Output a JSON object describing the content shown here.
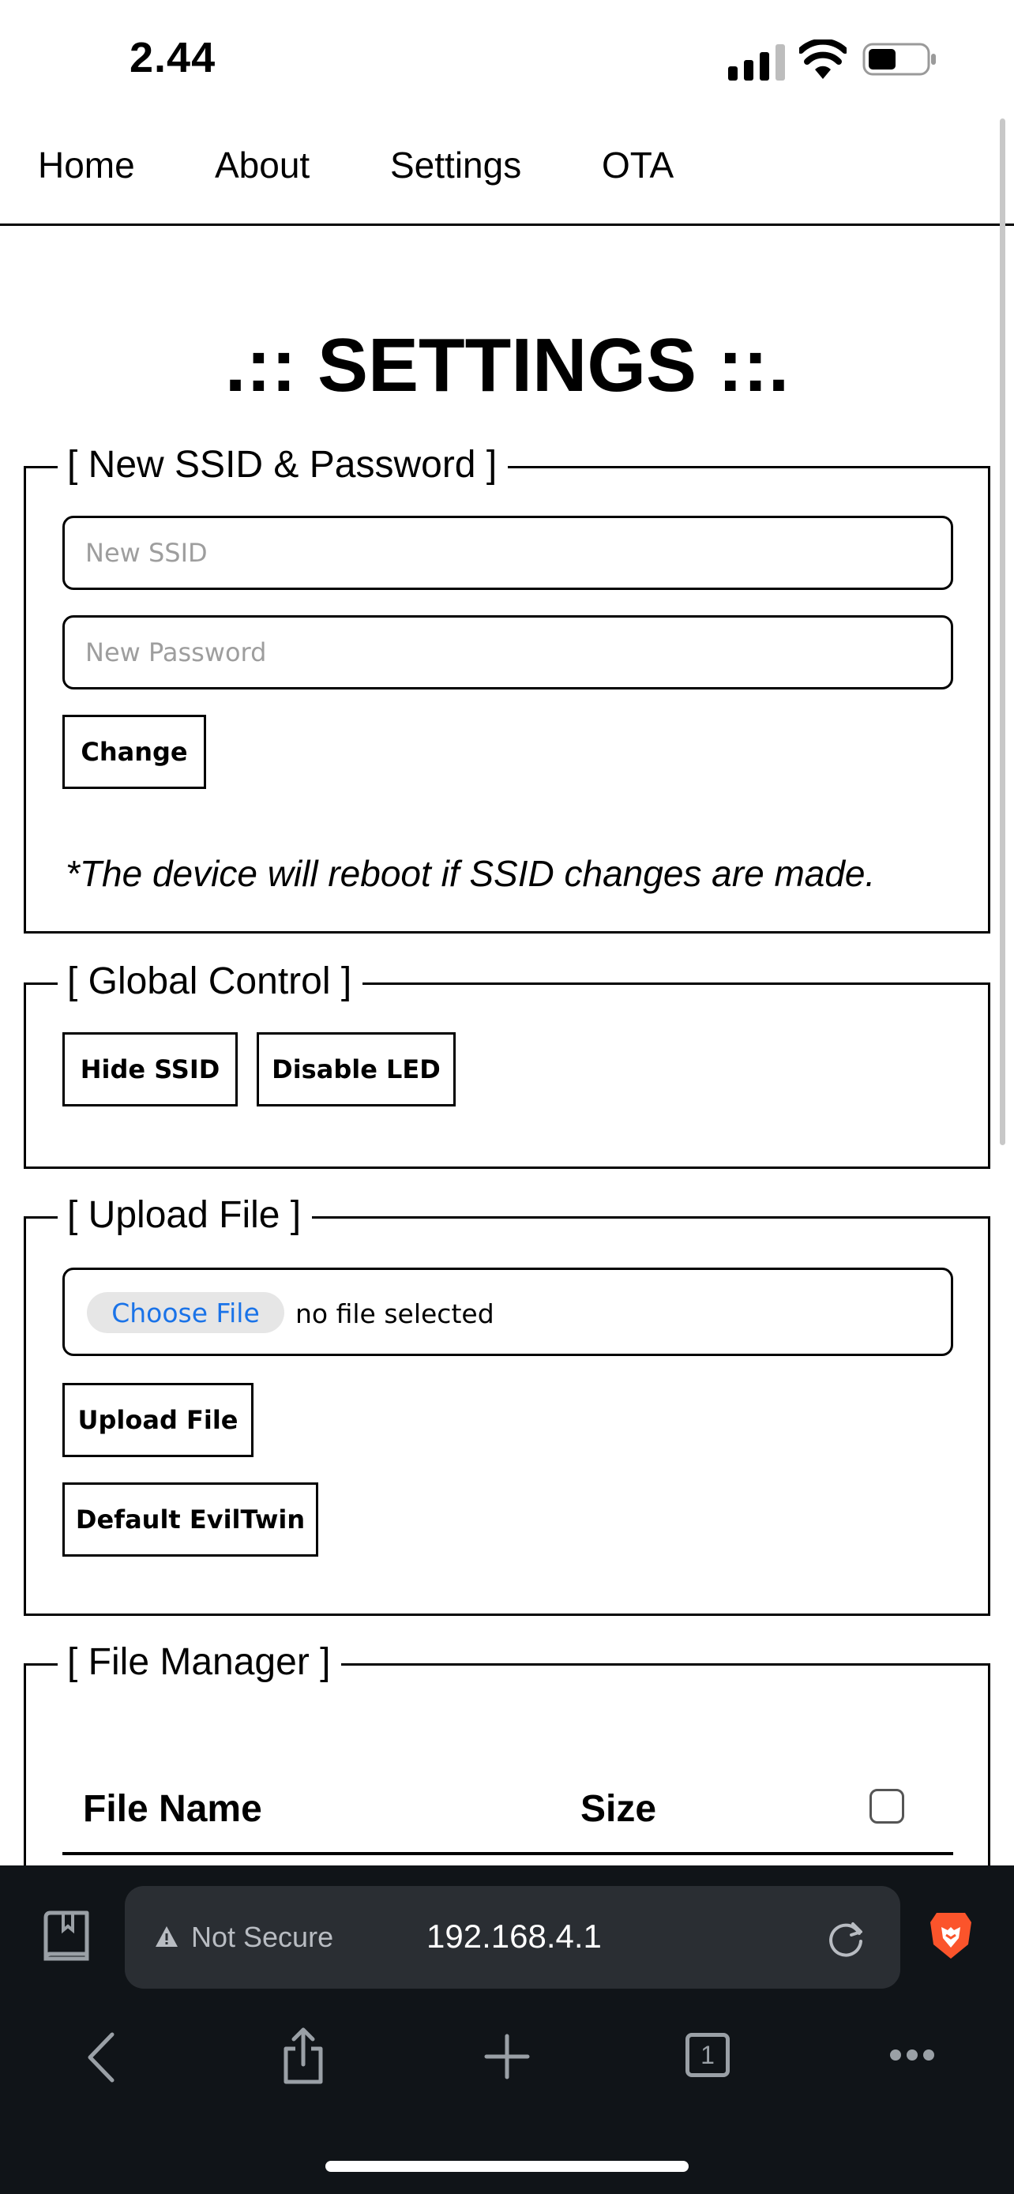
{
  "status_bar": {
    "time": "2.44"
  },
  "nav": {
    "links": [
      "Home",
      "About",
      "Settings",
      "OTA"
    ]
  },
  "page": {
    "title": ".:: SETTINGS ::."
  },
  "ssid_section": {
    "legend": "[ New SSID & Password ]",
    "ssid_placeholder": "New SSID",
    "password_placeholder": "New Password",
    "change_label": "Change",
    "note": "*The device will reboot if SSID changes are made."
  },
  "global_section": {
    "legend": "[ Global Control ]",
    "hide_ssid_label": "Hide SSID",
    "disable_led_label": "Disable LED"
  },
  "upload_section": {
    "legend": "[ Upload File ]",
    "choose_file_label": "Choose File",
    "no_file_text": "no file selected",
    "upload_label": "Upload File",
    "default_label": "Default EvilTwin"
  },
  "file_manager": {
    "legend": "[ File Manager ]",
    "columns": [
      "File Name",
      "Size"
    ]
  },
  "browser": {
    "security_label": "Not Secure",
    "url": "192.168.4.1",
    "tab_count": "1"
  },
  "colors": {
    "accent_link": "#1a73e8",
    "toolbar_bg": "#101418",
    "url_bar_bg": "#2a2e33",
    "brave_orange": "#fb542b"
  },
  "icons": [
    "signal-icon",
    "wifi-icon",
    "battery-icon",
    "bookmarks-icon",
    "warning-icon",
    "reload-icon",
    "brave-lion-icon",
    "back-icon",
    "share-icon",
    "new-tab-icon",
    "tabs-icon",
    "more-icon"
  ]
}
